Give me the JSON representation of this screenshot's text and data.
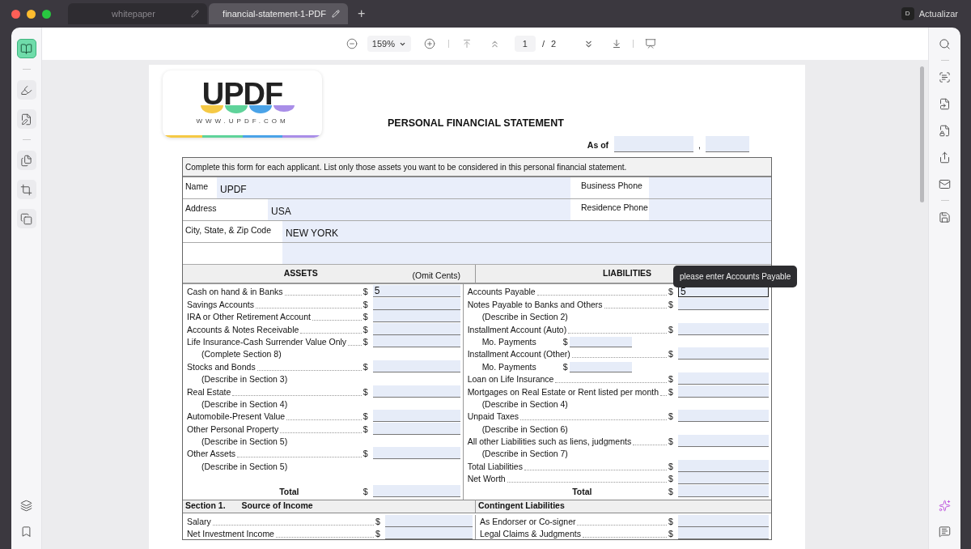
{
  "tabs": [
    {
      "label": "whitepaper",
      "selected": false
    },
    {
      "label": "financial-statement-1-PDF",
      "selected": true
    }
  ],
  "new_tab": "+",
  "account": {
    "initial": "D",
    "button": "Actualizar"
  },
  "left_tool_groups": [
    [
      {
        "kind": "reader",
        "selected": true
      }
    ],
    [
      {
        "kind": "highlight",
        "selected": false
      },
      {
        "kind": "edit",
        "selected": false
      }
    ],
    [
      {
        "kind": "organize",
        "selected": false
      },
      {
        "kind": "crop",
        "selected": false
      },
      {
        "kind": "compare",
        "selected": false
      }
    ]
  ],
  "left_bottom_tools": [
    {
      "kind": "layers"
    },
    {
      "kind": "bookmark"
    }
  ],
  "toolbar": {
    "zoom": "159%",
    "page": "1",
    "separator": "/",
    "pages": "2"
  },
  "right_tool_groups": [
    [
      {
        "kind": "search"
      }
    ],
    [
      {
        "kind": "ocr"
      },
      {
        "kind": "convert"
      },
      {
        "kind": "protect"
      },
      {
        "kind": "share"
      },
      {
        "kind": "mail"
      }
    ],
    [
      {
        "kind": "save"
      }
    ]
  ],
  "right_bottom_tools": [
    {
      "kind": "ai"
    },
    {
      "kind": "comment"
    }
  ],
  "document": {
    "logo": {
      "word": "UPDF",
      "url": "WWW.UPDF.COM"
    },
    "title": "PERSONAL FINANCIAL STATEMENT",
    "as_of": "As of",
    "as_of_comma": ",",
    "instructions": "Complete this form for each applicant.  List only those assets you want to be considered in this personal financial statement.",
    "applicant_rows": [
      {
        "label": "Name",
        "value": "UPDF",
        "right_label": "Business Phone"
      },
      {
        "label": "Address",
        "value": "USA",
        "right_label": "Residence Phone"
      },
      {
        "label": "City, State, & Zip Code",
        "value": "NEW YORK"
      },
      {}
    ],
    "assets": {
      "heading": "ASSETS",
      "note": "(Omit Cents)",
      "lines": [
        {
          "kind": "item",
          "label": "Cash on hand & in Banks",
          "currency": "$",
          "value": "5"
        },
        {
          "kind": "item",
          "label": "Savings Accounts",
          "currency": "$"
        },
        {
          "kind": "item",
          "label": "IRA or Other Retirement Account",
          "currency": "$"
        },
        {
          "kind": "item",
          "label": "Accounts & Notes Receivable",
          "currency": "$"
        },
        {
          "kind": "item",
          "label": "Life Insurance-Cash Surrender Value Only",
          "currency": "$"
        },
        {
          "kind": "note",
          "text": "(Complete Section 8)"
        },
        {
          "kind": "item",
          "label": "Stocks and Bonds",
          "currency": "$"
        },
        {
          "kind": "note",
          "text": "(Describe in Section 3)"
        },
        {
          "kind": "item",
          "label": "Real Estate",
          "currency": "$"
        },
        {
          "kind": "note",
          "text": "(Describe in Section 4)"
        },
        {
          "kind": "item",
          "label": "Automobile-Present Value",
          "currency": "$"
        },
        {
          "kind": "item",
          "label": "Other Personal Property",
          "currency": "$"
        },
        {
          "kind": "note",
          "text": "(Describe in Section 5)"
        },
        {
          "kind": "item",
          "label": "Other Assets",
          "currency": "$"
        },
        {
          "kind": "note",
          "text": "(Describe in Section 5)"
        },
        {
          "kind": "blank"
        },
        {
          "kind": "total",
          "label": "Total",
          "currency": "$"
        }
      ]
    },
    "liabilities": {
      "heading": "LIABILITIES",
      "lines": [
        {
          "kind": "item",
          "label": "Accounts Payable",
          "currency": "$",
          "value": "5",
          "focused": true
        },
        {
          "kind": "item",
          "label": "Notes Payable to Banks and Others",
          "currency": "$"
        },
        {
          "kind": "note",
          "text": "(Describe in Section 2)"
        },
        {
          "kind": "item",
          "label": "Installment Account (Auto)",
          "currency": "$"
        },
        {
          "kind": "payment",
          "label": "Mo. Payments",
          "currency": "$"
        },
        {
          "kind": "item",
          "label": "Installment Account (Other)",
          "currency": "$"
        },
        {
          "kind": "payment",
          "label": "Mo. Payments",
          "currency": "$"
        },
        {
          "kind": "item",
          "label": "Loan on Life Insurance",
          "currency": "$"
        },
        {
          "kind": "item",
          "label": "Mortgages on Real Estate or Rent listed per month",
          "currency": "$"
        },
        {
          "kind": "note",
          "text": "(Describe in Section 4)"
        },
        {
          "kind": "item",
          "label": "Unpaid Taxes",
          "currency": "$"
        },
        {
          "kind": "note",
          "text": "(Describe in Section 6)"
        },
        {
          "kind": "item",
          "label": "All other Liabilities such as liens, judgments",
          "currency": "$"
        },
        {
          "kind": "note",
          "text": "(Describe in Section 7)"
        },
        {
          "kind": "item",
          "label": "Total Liabilities",
          "currency": "$"
        },
        {
          "kind": "item",
          "label": "Net Worth",
          "currency": "$"
        },
        {
          "kind": "total",
          "label": "Total",
          "currency": "$"
        }
      ]
    },
    "section_1": {
      "number": "Section 1.",
      "title": "Source of Income",
      "lines": [
        {
          "kind": "item",
          "label": "Salary",
          "currency": "$"
        },
        {
          "kind": "item",
          "label": "Net Investment Income",
          "currency": "$"
        }
      ]
    },
    "contingent": {
      "title": "Contingent Liabilities",
      "lines": [
        {
          "kind": "item",
          "label": "As Endorser or Co-signer",
          "currency": "$"
        },
        {
          "kind": "item",
          "label": "Legal Claims & Judgments",
          "currency": "$"
        }
      ]
    }
  },
  "tooltip": "please enter Accounts Payable"
}
